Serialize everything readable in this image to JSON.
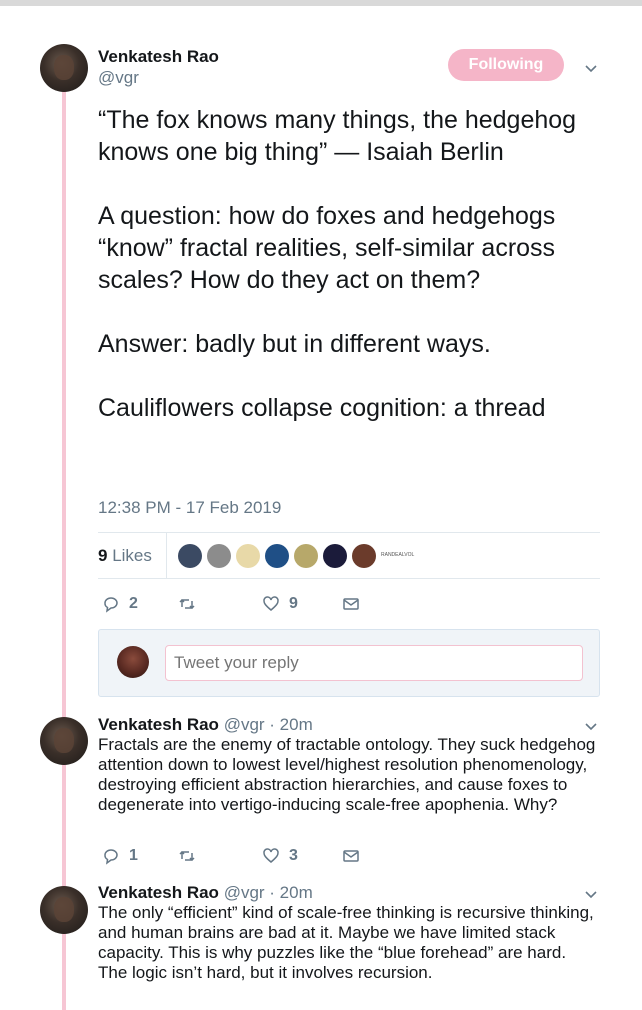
{
  "tweet": {
    "author_name": "Venkatesh Rao",
    "author_handle": "@vgr",
    "follow_label": "Following",
    "paragraphs": [
      "“The fox knows many things, the hedgehog knows one big thing” — Isaiah Berlin",
      "A question: how do foxes and hedgehogs “know” fractal realities, self-similar across scales? How do they act on them?",
      "Answer: badly but in different ways.",
      "Cauliflowers collapse cognition: a thread"
    ],
    "timestamp": "12:38 PM - 17 Feb 2019",
    "likes_number": "9",
    "likes_word": "Likes",
    "likers_overflow": "RANDEALVOL",
    "reply_count": "2",
    "retweet_count": "",
    "like_count": "9"
  },
  "reply_box": {
    "placeholder": "Tweet your reply"
  },
  "replies": [
    {
      "author_name": "Venkatesh Rao",
      "author_handle": "@vgr",
      "time": "· 20m",
      "text": "Fractals are the enemy of tractable ontology. They suck hedgehog attention down to lowest level/highest resolution phenomenology, destroying efficient abstraction hierarchies, and cause foxes to degenerate into vertigo-inducing scale-free apophenia. Why?",
      "reply_count": "1",
      "like_count": "3"
    },
    {
      "author_name": "Venkatesh Rao",
      "author_handle": "@vgr",
      "time": "· 20m",
      "text": "The only “efficient” kind of scale-free thinking is recursive thinking, and human brains are bad at it. Maybe we have limited stack capacity. This is why puzzles like the “blue forehead” are hard. The logic isn’t hard, but it involves recursion."
    }
  ],
  "colors": {
    "thread_line": "#f6c6d4",
    "follow_button": "#f5b5c8",
    "secondary_text": "#657786"
  },
  "icons": [
    "reply-icon",
    "retweet-icon",
    "like-icon",
    "dm-icon",
    "chevron-down-icon"
  ]
}
